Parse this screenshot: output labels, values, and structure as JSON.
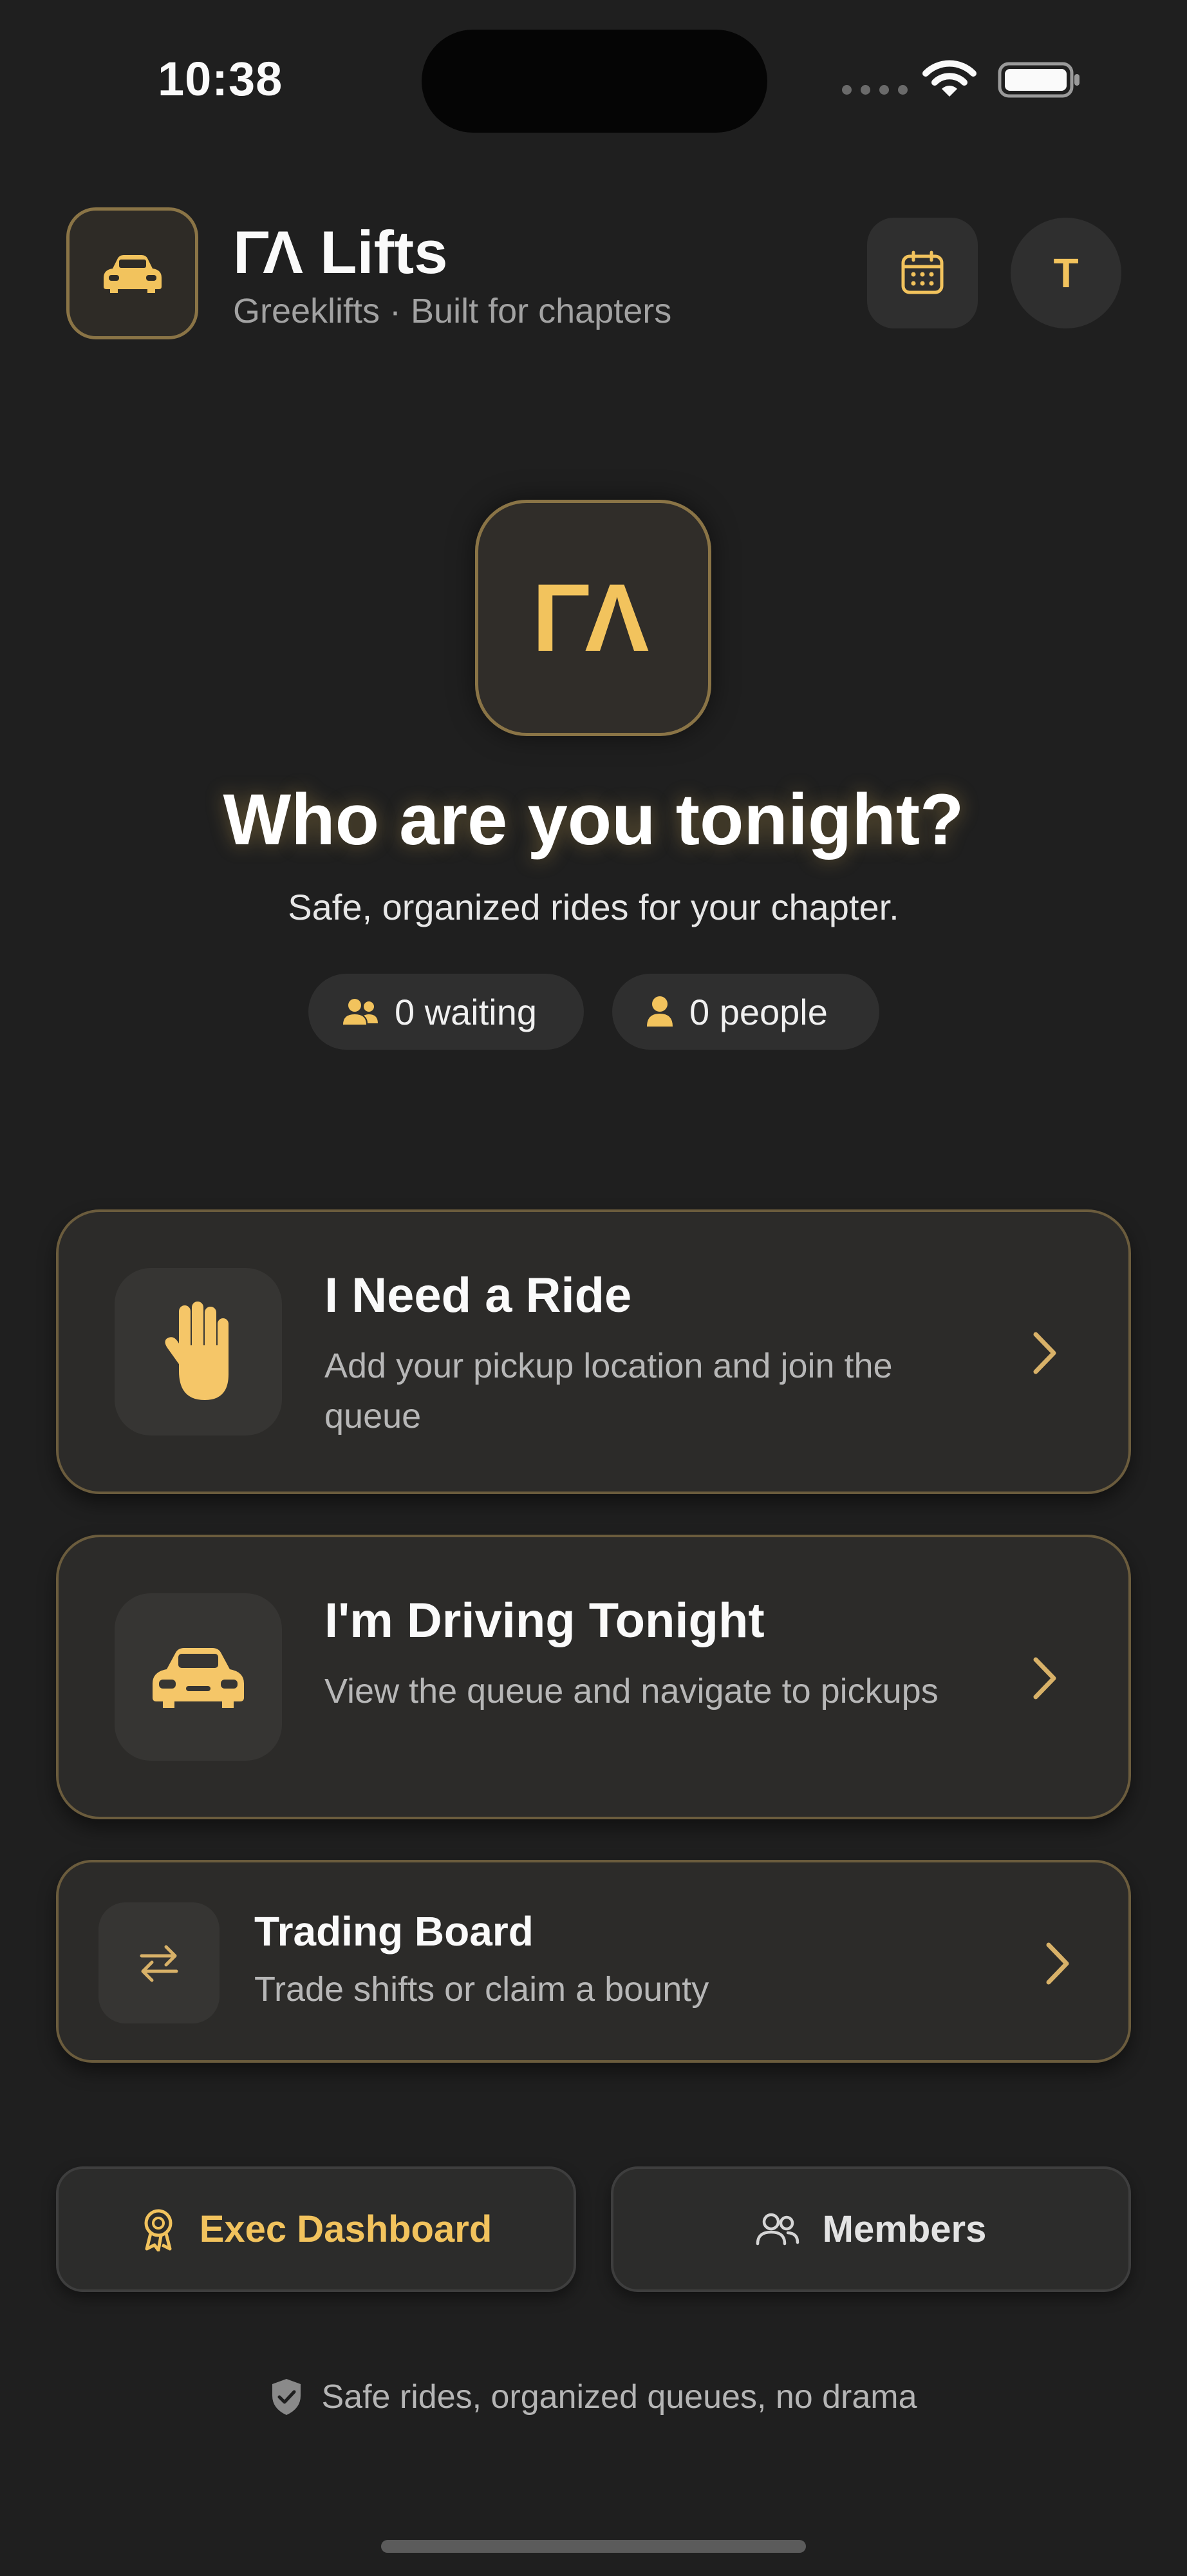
{
  "status_bar": {
    "time": "10:38"
  },
  "header": {
    "app_logo_icon": "car-icon",
    "title": "ΓΛ Lifts",
    "subtitle": "Greeklifts · Built for chapters",
    "calendar_icon": "calendar-icon",
    "avatar_initial": "T"
  },
  "hero": {
    "logo_text": "ΓΛ",
    "title": "Who are you tonight?",
    "subtitle": "Safe, organized rides for your chapter.",
    "waiting_label": "0 waiting",
    "people_label": "0 people"
  },
  "actions": {
    "ride": {
      "title": "I Need a Ride",
      "description": "Add your pickup location and join the queue",
      "icon": "hand-icon"
    },
    "drive": {
      "title": "I'm Driving Tonight",
      "description": "View the queue and navigate to pickups",
      "icon": "car-icon"
    },
    "trade": {
      "title": "Trading Board",
      "description": "Trade shifts or claim a bounty",
      "icon": "swap-icon"
    }
  },
  "bottom": {
    "exec_label": "Exec Dashboard",
    "members_label": "Members"
  },
  "footer": {
    "note": "Safe rides, organized queues, no drama"
  },
  "colors": {
    "accent": "#f2c35d",
    "background": "#1f1f1f",
    "card": "#2c2b29",
    "card_border": "#6b5c3d"
  }
}
